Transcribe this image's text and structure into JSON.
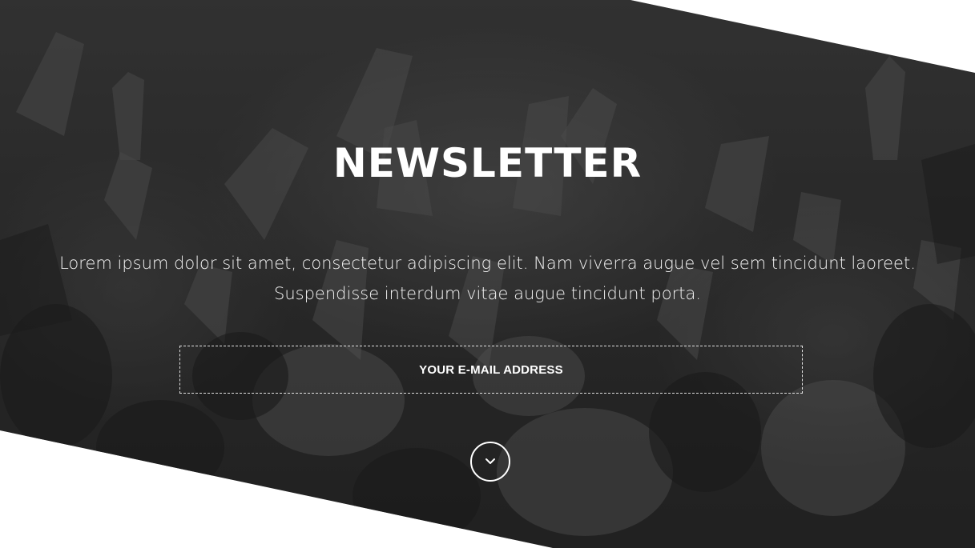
{
  "newsletter": {
    "title": "NEWSLETTER",
    "description": "Lorem ipsum dolor sit amet, consectetur adipiscing elit. Nam viverra augue vel sem tincidunt laoreet. Suspendisse interdum vitae augue tincidunt porta.",
    "email_placeholder": "YOUR E-MAIL ADDRESS",
    "email_value": "",
    "scroll_icon": "chevron-down-icon",
    "background_image": "concert-crowd-hands-raised",
    "colors": {
      "overlay": "#2e2e2e",
      "text": "#ffffff",
      "page_background": "#ffffff"
    }
  }
}
